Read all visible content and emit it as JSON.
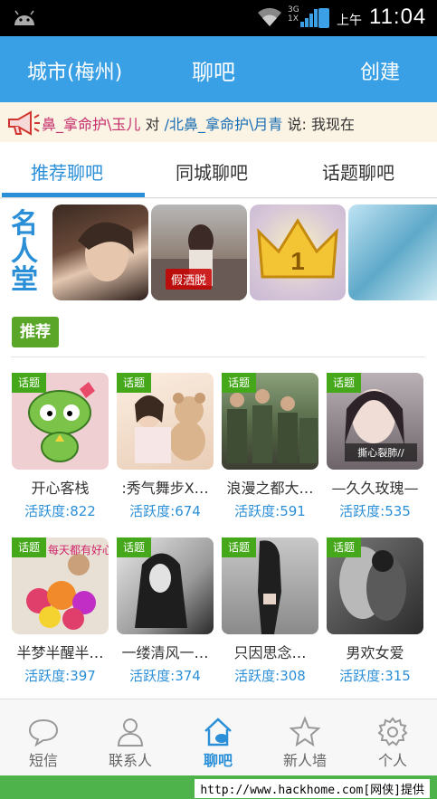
{
  "status_bar": {
    "time_prefix": "上午",
    "time": "11:04",
    "net": "3G",
    "net2": "1X"
  },
  "header": {
    "city": "城市(梅州)",
    "title": "聊吧",
    "create": "创建"
  },
  "ticker": {
    "user1": "鼻_拿命护\\玉儿",
    "mid": " 对 ",
    "user2": "/北鼻_拿命护\\月青",
    "end": " 说: 我现在"
  },
  "tabs": [
    {
      "label": "推荐聊吧"
    },
    {
      "label": "同城聊吧"
    },
    {
      "label": "话题聊吧"
    }
  ],
  "hall": {
    "label": "名人堂",
    "thumb2_caption": "假洒脱"
  },
  "recommend": {
    "badge": "推荐"
  },
  "topic_tag": "话题",
  "items": [
    {
      "name": "开心客栈",
      "activity": "活跃度:822"
    },
    {
      "name": ":秀气舞步X…",
      "activity": "活跃度:674"
    },
    {
      "name": "浪漫之都大…",
      "activity": "活跃度:591"
    },
    {
      "name": "—久久玫瑰—",
      "activity": "活跃度:535"
    },
    {
      "name": "半梦半醒半…",
      "activity": "活跃度:397"
    },
    {
      "name": "一缕清风一…",
      "activity": "活跃度:374"
    },
    {
      "name": "只因思念…",
      "activity": "活跃度:308"
    },
    {
      "name": "男欢女爱",
      "activity": "活跃度:315"
    }
  ],
  "item_captions": {
    "i4": "撕心裂肺//",
    "i5": "每天都有好心情"
  },
  "bottom_nav": [
    {
      "label": "短信",
      "icon": "chat-bubble-icon"
    },
    {
      "label": "联系人",
      "icon": "person-icon"
    },
    {
      "label": "聊吧",
      "icon": "home-chat-icon"
    },
    {
      "label": "新人墙",
      "icon": "star-icon"
    },
    {
      "label": "个人",
      "icon": "gear-icon"
    }
  ],
  "footer": {
    "url": "http://www.hackhome.com[网侠]提供"
  },
  "colors": {
    "accent": "#3aa0e5",
    "tab_active": "#2b8fd8",
    "tag_green": "#45a81a"
  }
}
